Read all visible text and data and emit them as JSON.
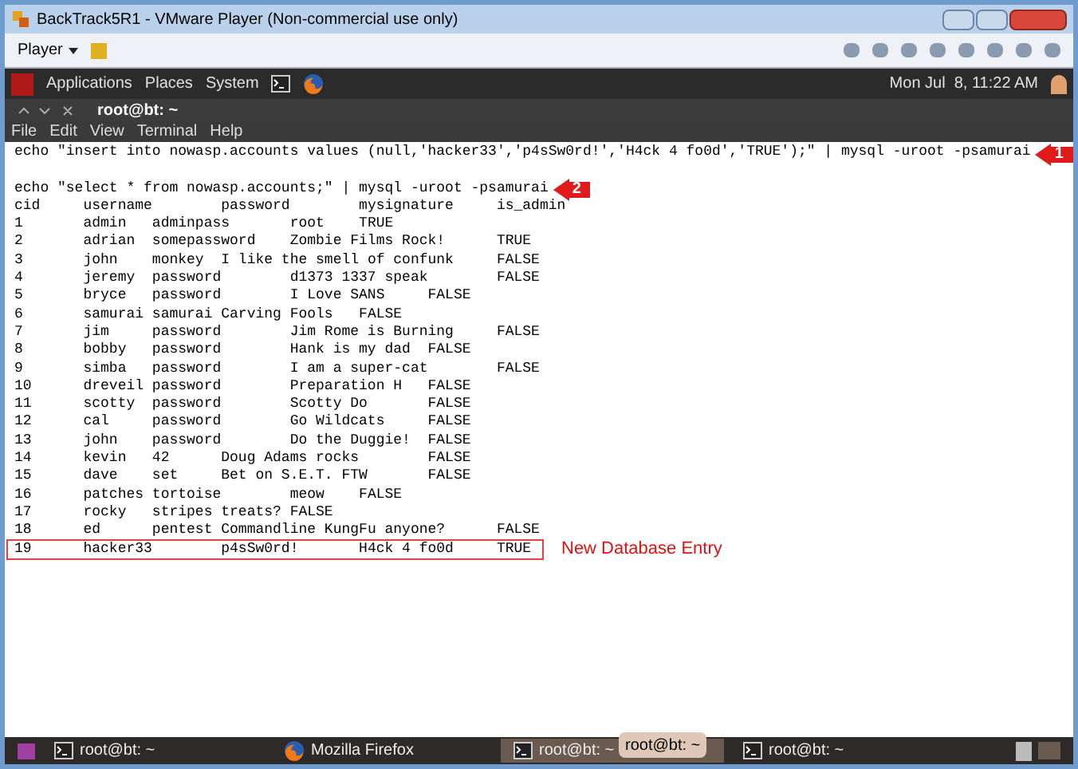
{
  "window": {
    "title": "BackTrack5R1 - VMware Player (Non-commercial use only)"
  },
  "toolbar": {
    "player_menu": "Player"
  },
  "panel": {
    "menus": [
      "Applications",
      "Places",
      "System"
    ],
    "clock": "Mon Jul  8, 11:22 AM"
  },
  "terminal": {
    "title": "root@bt: ~",
    "menu": [
      "File",
      "Edit",
      "View",
      "Terminal",
      "Help"
    ],
    "lines": [
      {
        "text": "echo \"insert into nowasp.accounts values (null,'hacker33','p4sSw0rd!','H4ck 4 fo0d','TRUE');\" | mysql -uroot -psamurai",
        "highlighted": false,
        "callout": "1"
      },
      {
        "highlighted": false
      },
      {
        "text": "echo \"select * from nowasp.accounts;\" | mysql -uroot -psamurai",
        "highlighted": false,
        "callout": "2"
      },
      {
        "text": "cid\tusername\tpassword\tmysignature\tis_admin",
        "highlighted": false
      },
      {
        "text": "1\tadmin\tadminpass\troot\tTRUE",
        "highlighted": false
      },
      {
        "text": "2\tadrian\tsomepassword\tZombie Films Rock!\tTRUE",
        "highlighted": false
      },
      {
        "text": "3\tjohn\tmonkey\tI like the smell of confunk\tFALSE",
        "highlighted": false
      },
      {
        "text": "4\tjeremy\tpassword\td1373 1337 speak\tFALSE",
        "highlighted": false
      },
      {
        "text": "5\tbryce\tpassword\tI Love SANS\tFALSE",
        "highlighted": false
      },
      {
        "text": "6\tsamurai\tsamurai\tCarving Fools\tFALSE",
        "highlighted": false
      },
      {
        "text": "7\tjim\tpassword\tJim Rome is Burning\tFALSE",
        "highlighted": false
      },
      {
        "text": "8\tbobby\tpassword\tHank is my dad\tFALSE",
        "highlighted": false
      },
      {
        "text": "9\tsimba\tpassword\tI am a super-cat\tFALSE",
        "highlighted": false
      },
      {
        "text": "10\tdreveil\tpassword\tPreparation H\tFALSE",
        "highlighted": false
      },
      {
        "text": "11\tscotty\tpassword\tScotty Do\tFALSE",
        "highlighted": false
      },
      {
        "text": "12\tcal\tpassword\tGo Wildcats\tFALSE",
        "highlighted": false
      },
      {
        "text": "13\tjohn\tpassword\tDo the Duggie!\tFALSE",
        "highlighted": false
      },
      {
        "text": "14\tkevin\t42\tDoug Adams rocks\tFALSE",
        "highlighted": false
      },
      {
        "text": "15\tdave\tset\tBet on S.E.T. FTW\tFALSE",
        "highlighted": false
      },
      {
        "text": "16\tpatches\ttortoise\tmeow\tFALSE",
        "highlighted": false
      },
      {
        "text": "17\trocky\tstripes\ttreats?\tFALSE",
        "highlighted": false
      },
      {
        "text": "18\ted\tpentest\tCommandline KungFu anyone?\tFALSE",
        "highlighted": false
      },
      {
        "text": "19\thacker33\tp4sSw0rd!\tH4ck 4 fo0d\tTRUE",
        "highlighted": true,
        "note": "New Database Entry"
      }
    ]
  },
  "taskbar": {
    "items": [
      {
        "label": "root@bt: ~",
        "kind": "terminal",
        "selected": false
      },
      {
        "label": "Mozilla Firefox",
        "kind": "browser",
        "selected": false
      },
      {
        "label": "root@bt: ~",
        "kind": "terminal",
        "selected": true
      },
      {
        "label": "root@bt: ~",
        "kind": "terminal",
        "selected": false
      }
    ],
    "tooltip": "root@bt: ~"
  }
}
